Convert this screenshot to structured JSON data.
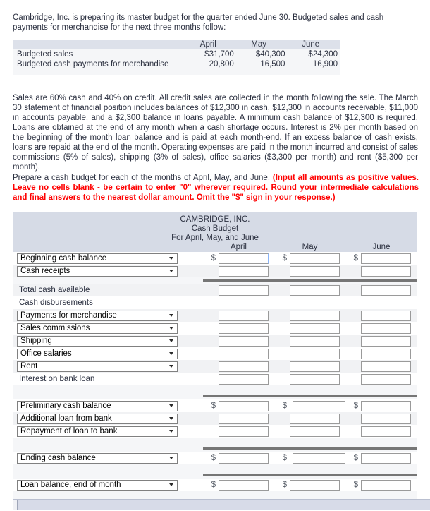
{
  "intro": {
    "text": "Cambridge, Inc. is preparing its master budget for the quarter ended June 30. Budgeted sales and cash payments for merchandise for the next three months follow:"
  },
  "given_table": {
    "columns": [
      "",
      "April",
      "May",
      "June"
    ],
    "rows": [
      {
        "label": "Budgeted sales",
        "april": "$31,700",
        "may": "$40,300",
        "june": "$24,300"
      },
      {
        "label": "Budgeted cash payments for merchandise",
        "april": "20,800",
        "may": "16,500",
        "june": "16,900"
      }
    ]
  },
  "assumptions": {
    "text": "Sales are 60% cash and 40% on credit. All credit sales are collected in the month following the sale. The March 30 statement of financial position includes balances of $12,300 in cash, $12,300 in accounts receivable, $11,000 in accounts payable, and a $2,300 balance in loans payable. A minimum cash balance of $12,300 is required. Loans are obtained at the end of any month when a cash shortage occurs. Interest is 2% per month based on the beginning of the month loan balance and is paid at each month-end. If an excess balance of cash exists, loans are repaid at the end of the month. Operating expenses are paid in the month incurred and consist of sales commissions (5% of sales), shipping (3% of sales), office salaries ($3,300 per month) and rent ($5,300 per month)."
  },
  "requirement": {
    "lead": "Prepare a cash budget for each of the months of April, May, and June. ",
    "emphasis": "(Input all amounts as positive values. Leave no cells blank - be certain to enter \"0\" wherever required. Round your intermediate calculations and final answers to the nearest dollar amount. Omit the \"$\" sign in your response.)",
    "emphasis_color": "#ff0000"
  },
  "budget_form": {
    "title_line1": "CAMBRIDGE, INC.",
    "title_line2": "Cash Budget",
    "title_line3": "For April, May, and June",
    "month_headers": [
      "April",
      "May",
      "June"
    ],
    "rows": {
      "beginning_cash_balance": "Beginning cash balance",
      "cash_receipts": "Cash receipts",
      "total_cash_available": "Total cash available",
      "cash_disbursements": "Cash disbursements",
      "payments_for_merchandise": "Payments for merchandise",
      "sales_commissions": "Sales commissions",
      "shipping": "Shipping",
      "office_salaries": "Office salaries",
      "rent": "Rent",
      "interest_on_bank_loan": "Interest on bank loan",
      "preliminary_cash_balance": "Preliminary cash balance",
      "additional_loan_from_bank": "Additional loan from bank",
      "repayment_of_loan_to_bank": "Repayment of loan to bank",
      "ending_cash_balance": "Ending cash balance",
      "loan_balance_end_of_month": "Loan balance, end of month"
    },
    "input_values": {
      "beginning_cash_balance": [
        "",
        "",
        ""
      ],
      "cash_receipts": [
        "",
        "",
        ""
      ],
      "total_cash_available": [
        "",
        "",
        ""
      ],
      "payments_for_merchandise": [
        "",
        "",
        ""
      ],
      "sales_commissions": [
        "",
        "",
        ""
      ],
      "shipping": [
        "",
        "",
        ""
      ],
      "office_salaries": [
        "",
        "",
        ""
      ],
      "rent": [
        "",
        "",
        ""
      ],
      "interest_on_bank_loan": [
        "",
        "",
        ""
      ],
      "preliminary_cash_balance": [
        "",
        "",
        ""
      ],
      "additional_loan_from_bank": [
        "",
        "",
        ""
      ],
      "repayment_of_loan_to_bank": [
        "",
        "",
        ""
      ],
      "ending_cash_balance": [
        "",
        "",
        ""
      ],
      "loan_balance_end_of_month": [
        "",
        "",
        ""
      ]
    },
    "currency_symbol": "$",
    "header_band_color": "#d6dbe6",
    "row_alt_color": "#f1f2f4"
  }
}
